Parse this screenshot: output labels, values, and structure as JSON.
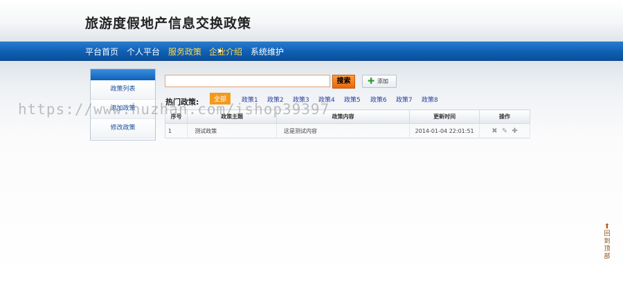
{
  "header": {
    "title": "旅游度假地产信息交换政策"
  },
  "nav": {
    "items": [
      {
        "label": "平台首页"
      },
      {
        "label": "个人平台"
      },
      {
        "label": "服务政策"
      },
      {
        "label": "企业介绍"
      },
      {
        "label": "系统维护"
      }
    ]
  },
  "sidebar": {
    "items": [
      {
        "label": "政策列表"
      },
      {
        "label": "添加政策"
      },
      {
        "label": "修改政策"
      }
    ]
  },
  "search": {
    "value": "",
    "placeholder": "",
    "button_label": "搜索",
    "add_label": "添加"
  },
  "hot": {
    "label": "热门政策:",
    "tags": [
      "全部",
      "政策1",
      "政策2",
      "政策3",
      "政策4",
      "政策5",
      "政策6",
      "政策7",
      "政策8"
    ]
  },
  "table": {
    "headers": [
      "序号",
      "政策主题",
      "政策内容",
      "更新时间",
      "操作"
    ],
    "rows": [
      {
        "id": "1",
        "topic": "测试政策",
        "content": "这是测试内容",
        "time": "2014-01-04 22:01:51"
      }
    ]
  },
  "watermark": "https://www.huzhan.com/ishop39397",
  "back_to_top": {
    "label_1": "回",
    "label_2": "到",
    "label_3": "顶",
    "label_4": "部"
  },
  "colors": {
    "nav_bg": "#0f5fb3",
    "active_nav": "#ffd84a",
    "search_btn": "#e9670c",
    "active_tag": "#f39a1e"
  }
}
